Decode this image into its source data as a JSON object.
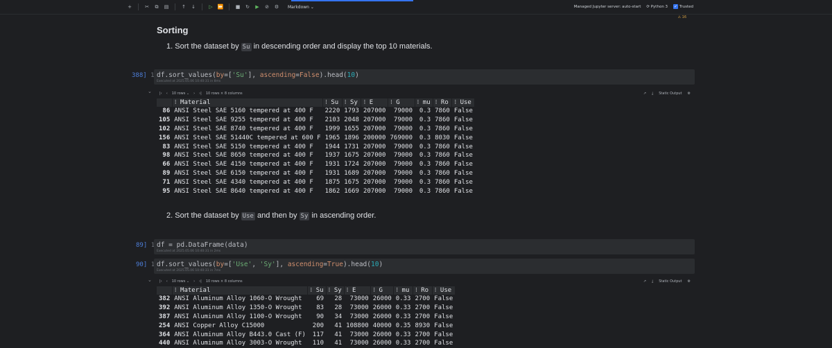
{
  "toolbar": {
    "mode": "Markdown",
    "server": "Managed Jupyter server: auto-start",
    "kernel": "Python 3",
    "trusted": "Trusted",
    "warnings": "⚠ 16"
  },
  "section": {
    "heading": "Sorting",
    "step1_num": "1.",
    "step1_pre": "Sort the dataset by",
    "step1_code": "Su",
    "step1_post": "in descending order and display the top 10 materials.",
    "step2_num": "2.",
    "step2_pre": "Sort the dataset by",
    "step2_code1": "Use",
    "step2_mid": "and then by",
    "step2_code2": "Sy",
    "step2_post": "in ascending order."
  },
  "cells": [
    {
      "num": "388]",
      "line": "1",
      "exec": "Executed at 2025.05.06 10:40:31 in 8ms"
    },
    {
      "num": "89]",
      "line": "1",
      "code": "df = pd.DataFrame(data)",
      "exec": "Executed at 2025.05.06 10:40:31 in 2ms"
    },
    {
      "num": "90]",
      "line": "1",
      "exec": "Executed at 2025.05.06 10:40:31 in 7ms"
    }
  ],
  "output": {
    "rows_select": "10 rows",
    "shape": "10 rows × 8 columns",
    "static": "Static Output"
  },
  "columns": [
    "Material",
    "Su",
    "Sy",
    "E",
    "G",
    "mu",
    "Ro",
    "Use"
  ],
  "table1": [
    [
      "86",
      "ANSI Steel SAE 5160 tempered at 400 F",
      "2220",
      "1793",
      "207000",
      "79000",
      "0.3",
      "7860",
      "False"
    ],
    [
      "105",
      "ANSI Steel SAE 9255 tempered at 400 F",
      "2103",
      "2048",
      "207000",
      "79000",
      "0.3",
      "7860",
      "False"
    ],
    [
      "102",
      "ANSI Steel SAE 8740 tempered at 400 F",
      "1999",
      "1655",
      "207000",
      "79000",
      "0.3",
      "7860",
      "False"
    ],
    [
      "156",
      "ANSI Steel SAE 51440C tempered at 600 F",
      "1965",
      "1896",
      "200000",
      "769000",
      "0.3",
      "8030",
      "False"
    ],
    [
      "83",
      "ANSI Steel SAE 5150 tempered at 400 F",
      "1944",
      "1731",
      "207000",
      "79000",
      "0.3",
      "7860",
      "False"
    ],
    [
      "98",
      "ANSI Steel SAE 8650 tempered at 400 F",
      "1937",
      "1675",
      "207000",
      "79000",
      "0.3",
      "7860",
      "False"
    ],
    [
      "66",
      "ANSI Steel SAE 4150 tempered at 400 F",
      "1931",
      "1724",
      "207000",
      "79000",
      "0.3",
      "7860",
      "False"
    ],
    [
      "89",
      "ANSI Steel SAE 6150 tempered at 400 F",
      "1931",
      "1689",
      "207000",
      "79000",
      "0.3",
      "7860",
      "False"
    ],
    [
      "71",
      "ANSI Steel SAE 4340 tempered at 400 F",
      "1875",
      "1675",
      "207000",
      "79000",
      "0.3",
      "7860",
      "False"
    ],
    [
      "95",
      "ANSI Steel SAE 8640 tempered at 400 F",
      "1862",
      "1669",
      "207000",
      "79000",
      "0.3",
      "7860",
      "False"
    ]
  ],
  "table2": [
    [
      "382",
      "ANSI Aluminum Alloy 1060-O Wrought",
      "69",
      "28",
      "73000",
      "26000",
      "0.33",
      "2700",
      "False"
    ],
    [
      "392",
      "ANSI Aluminum Alloy 1350-O Wrought",
      "83",
      "28",
      "73000",
      "26000",
      "0.33",
      "2700",
      "False"
    ],
    [
      "387",
      "ANSI Aluminum Alloy 1100-O Wrought",
      "90",
      "34",
      "73000",
      "26000",
      "0.33",
      "2700",
      "False"
    ],
    [
      "254",
      "ANSI Copper Alloy C15000",
      "200",
      "41",
      "108800",
      "40000",
      "0.35",
      "8930",
      "False"
    ],
    [
      "364",
      "ANSI Aluminum Alloy B443.0 Cast (F)",
      "117",
      "41",
      "73000",
      "26000",
      "0.33",
      "2700",
      "False"
    ],
    [
      "440",
      "ANSI Aluminum Alloy 3003-O Wrought",
      "110",
      "41",
      "73000",
      "26000",
      "0.33",
      "2700",
      "False"
    ]
  ]
}
